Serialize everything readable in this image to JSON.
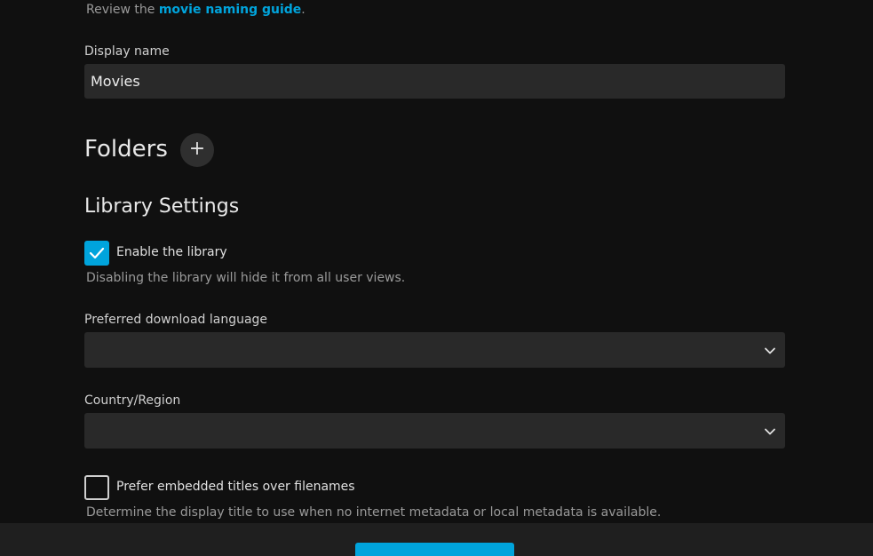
{
  "naming_hint": {
    "prefix": "Review the ",
    "link": "movie naming guide",
    "suffix": "."
  },
  "display_name": {
    "label": "Display name",
    "value": "Movies"
  },
  "folders": {
    "title": "Folders",
    "add_icon": "plus-icon",
    "add_glyph": "+"
  },
  "library_settings": {
    "title": "Library Settings",
    "enable_library": {
      "label": "Enable the library",
      "checked": true,
      "hint": "Disabling the library will hide it from all user views."
    },
    "preferred_language": {
      "label": "Preferred download language",
      "value": ""
    },
    "country_region": {
      "label": "Country/Region",
      "value": ""
    },
    "prefer_embedded_titles": {
      "label": "Prefer embedded titles over filenames",
      "checked": false,
      "hint": "Determine the display title to use when no internet metadata or local metadata is available."
    }
  },
  "colors": {
    "accent": "#00a4dc",
    "background": "#101010",
    "input_background": "#292929"
  }
}
